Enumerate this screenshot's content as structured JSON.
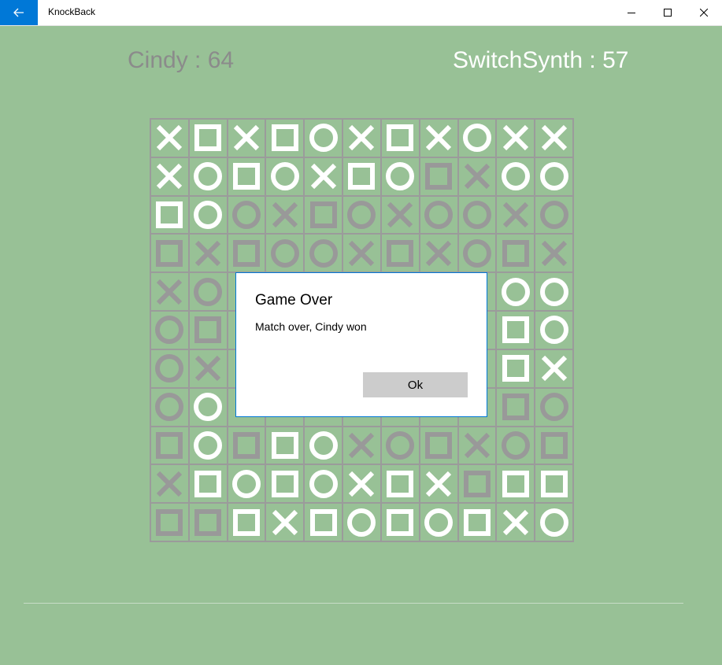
{
  "window": {
    "title": "KnockBack"
  },
  "scores": {
    "player1": "Cindy : 64",
    "player2": "SwitchSynth : 57"
  },
  "colors": {
    "white_piece": "#ffffff",
    "gray_piece": "#999999",
    "board_bg": "#98c196",
    "accent": "#0078d7"
  },
  "piece_legend": {
    "X": "x-mark",
    "S": "square",
    "O": "circle",
    "w": "white",
    "g": "gray"
  },
  "board": [
    [
      "Xw",
      "Sw",
      "Xw",
      "Sw",
      "Ow",
      "Xw",
      "Sw",
      "Xw",
      "Ow",
      "Xw",
      "Xw"
    ],
    [
      "Xw",
      "Ow",
      "Sw",
      "Ow",
      "Xw",
      "Sw",
      "Ow",
      "Sg",
      "Xg",
      "Ow",
      "Ow"
    ],
    [
      "Sw",
      "Ow",
      "Og",
      "Xg",
      "Sg",
      "Og",
      "Xg",
      "Og",
      "Og",
      "Xg",
      "Og"
    ],
    [
      "Sg",
      "Xg",
      "Sg",
      "Og",
      "Og",
      "Xg",
      "Sg",
      "Xg",
      "Og",
      "Sg",
      "Xg"
    ],
    [
      "Xg",
      "Og",
      "",
      "",
      "",
      "",
      "",
      "",
      "",
      "Ow",
      "Ow"
    ],
    [
      "Og",
      "Sg",
      "",
      "",
      "",
      "",
      "",
      "",
      "",
      "Sw",
      "Ow"
    ],
    [
      "Og",
      "Xg",
      "",
      "",
      "",
      "",
      "",
      "",
      "",
      "Sw",
      "Xw"
    ],
    [
      "Og",
      "Ow",
      "",
      "",
      "",
      "",
      "",
      "",
      "",
      "Sg",
      "Og"
    ],
    [
      "Sg",
      "Ow",
      "Sg",
      "Sw",
      "Ow",
      "Xg",
      "Og",
      "Sg",
      "Xg",
      "Og",
      "Sg"
    ],
    [
      "Xg",
      "Sw",
      "Ow",
      "Sw",
      "Ow",
      "Xw",
      "Sw",
      "Xw",
      "Sg",
      "Sw",
      "Sw"
    ],
    [
      "Sg",
      "Sg",
      "Sw",
      "Xw",
      "Sw",
      "Ow",
      "Sw",
      "Ow",
      "Sw",
      "Xw",
      "Ow"
    ]
  ],
  "dialog": {
    "title": "Game Over",
    "message": "Match over, Cindy won",
    "ok_label": "Ok"
  }
}
